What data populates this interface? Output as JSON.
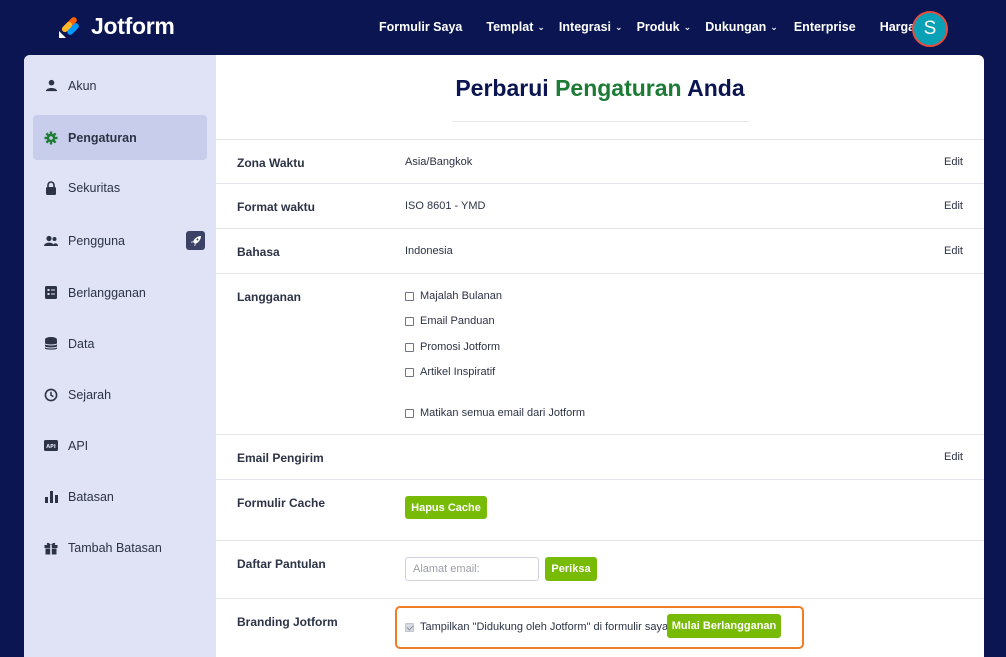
{
  "brand": {
    "name": "Jotform",
    "colors": {
      "nav_bg": "#0a1551",
      "accent_green": "#78bb07",
      "title_green": "#1e7b36",
      "highlight_orange": "#f07c25"
    }
  },
  "nav": {
    "items": [
      {
        "label": "Formulir Saya",
        "dropdown": false
      },
      {
        "label": "Templat",
        "dropdown": true
      },
      {
        "label": "Integrasi",
        "dropdown": true
      },
      {
        "label": "Produk",
        "dropdown": true
      },
      {
        "label": "Dukungan",
        "dropdown": true
      },
      {
        "label": "Enterprise",
        "dropdown": false
      },
      {
        "label": "Harga",
        "dropdown": false
      }
    ],
    "avatar_initial": "S"
  },
  "sidebar": {
    "items": [
      {
        "label": "Akun",
        "icon": "user-icon"
      },
      {
        "label": "Pengaturan",
        "icon": "gear-icon",
        "active": true
      },
      {
        "label": "Sekuritas",
        "icon": "lock-icon"
      },
      {
        "label": "Pengguna",
        "icon": "users-icon"
      },
      {
        "label": "Berlangganan",
        "icon": "invoice-icon"
      },
      {
        "label": "Data",
        "icon": "database-icon"
      },
      {
        "label": "Sejarah",
        "icon": "history-icon"
      },
      {
        "label": "API",
        "icon": "api-icon"
      },
      {
        "label": "Batasan",
        "icon": "bar-chart-icon"
      },
      {
        "label": "Tambah Batasan",
        "icon": "gift-icon"
      }
    ]
  },
  "page": {
    "title_part1": "Perbarui",
    "title_part2": "Pengaturan",
    "title_part3": "Anda"
  },
  "settings": {
    "timezone": {
      "label": "Zona Waktu",
      "value": "Asia/Bangkok",
      "edit": "Edit"
    },
    "time_format": {
      "label": "Format waktu",
      "value": "ISO 8601 - YMD",
      "edit": "Edit"
    },
    "language": {
      "label": "Bahasa",
      "value": "Indonesia",
      "edit": "Edit"
    },
    "subscriptions": {
      "label": "Langganan",
      "options": [
        "Majalah Bulanan",
        "Email Panduan",
        "Promosi Jotform",
        "Artikel Inspiratif"
      ],
      "unsubscribe_all": "Matikan semua email dari Jotform"
    },
    "sender_email": {
      "label": "Email Pengirim",
      "edit": "Edit"
    },
    "form_cache": {
      "label": "Formulir Cache",
      "button": "Hapus Cache"
    },
    "bounce_list": {
      "label": "Daftar Pantulan",
      "placeholder": "Alamat email:",
      "button": "Periksa"
    },
    "branding": {
      "label": "Branding Jotform",
      "checkbox_label": "Tampilkan \"Didukung oleh Jotform\" di formulir saya",
      "button": "Mulai Berlangganan"
    }
  }
}
